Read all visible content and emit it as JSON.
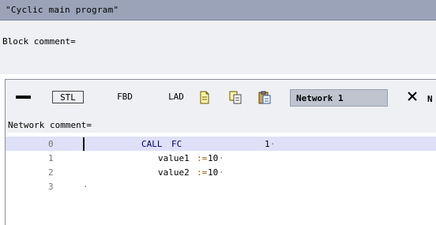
{
  "block": {
    "title": "\"Cyclic main program\"",
    "comment_label": "Block comment="
  },
  "toolbar": {
    "stl_label": "STL",
    "fbd_label": "FBD",
    "lad_label": "LAD",
    "network_title": "Network 1",
    "truncated_label": "N",
    "icons": [
      "new-network-icon",
      "copy-icon",
      "paste-icon",
      "close-icon",
      "minimize-icon"
    ]
  },
  "network": {
    "comment_label": "Network comment=",
    "lines": [
      {
        "number": "0",
        "instruction": "CALL",
        "operand": "FC",
        "value": "1",
        "selected": true
      },
      {
        "number": "1",
        "param": "value1",
        "op": ":=",
        "value": "10"
      },
      {
        "number": "2",
        "param": "value2",
        "op": ":=",
        "value": "10"
      },
      {
        "number": "3"
      }
    ]
  },
  "colors": {
    "title_bar": "#9aa3b8",
    "panel_bg": "#eff0f4",
    "selected_row": "#dfe0f8",
    "network_title_bg": "#bfc4cf"
  }
}
